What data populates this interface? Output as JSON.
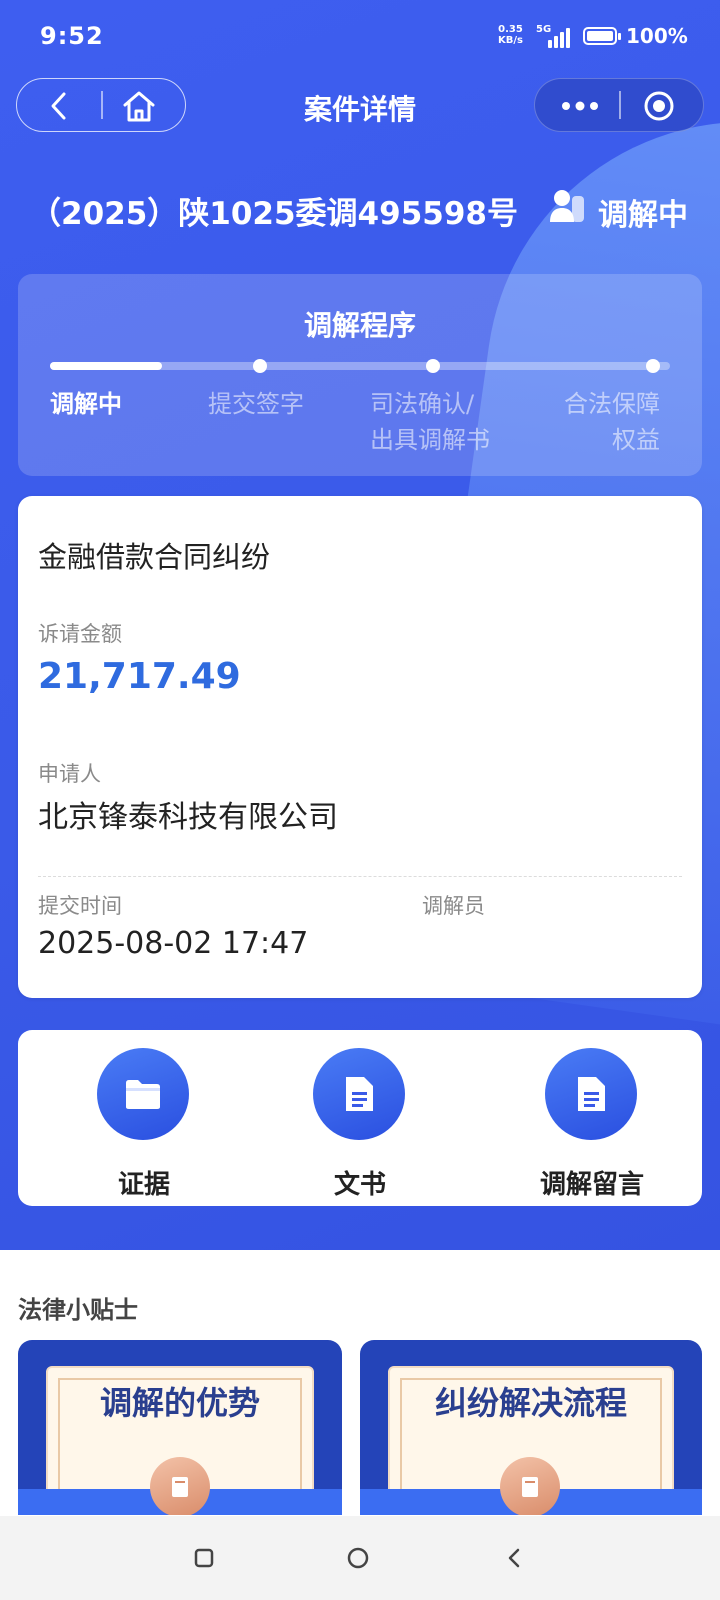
{
  "status_bar": {
    "time": "9:52",
    "net_speed_value": "0.35",
    "net_speed_unit": "KB/s",
    "network_type": "5G",
    "battery_percent": "100%"
  },
  "nav": {
    "title": "案件详情"
  },
  "case": {
    "number": "（2025）陕1025委调495598号",
    "status": "调解中"
  },
  "process": {
    "title": "调解程序",
    "progress_fraction": 0.18,
    "steps": [
      {
        "label": "调解中",
        "active": true
      },
      {
        "label": "提交签字",
        "active": false
      },
      {
        "label": "司法确认/",
        "label2": "出具调解书",
        "active": false
      },
      {
        "label": "合法保障",
        "label2": "权益",
        "active": false
      }
    ]
  },
  "detail": {
    "case_type": "金融借款合同纠纷",
    "amount_label": "诉请金额",
    "amount": "21,717.49",
    "applicant_label": "申请人",
    "applicant": "北京锋泰科技有限公司",
    "submit_time_label": "提交时间",
    "submit_time": "2025-08-02 17:47",
    "mediator_label": "调解员",
    "mediator": ""
  },
  "actions": [
    {
      "label": "证据",
      "icon": "folder-icon"
    },
    {
      "label": "文书",
      "icon": "document-icon"
    },
    {
      "label": "调解留言",
      "icon": "document-icon"
    }
  ],
  "tips": {
    "title": "法律小贴士",
    "cards": [
      {
        "title": "调解的优势",
        "icon": "book-icon"
      },
      {
        "title": "纠纷解决流程",
        "icon": "book-icon"
      }
    ]
  },
  "colors": {
    "primary_blue": "#3e5ef0",
    "amount_blue": "#2f6bdf",
    "tip_card_blue": "#2444b8"
  }
}
